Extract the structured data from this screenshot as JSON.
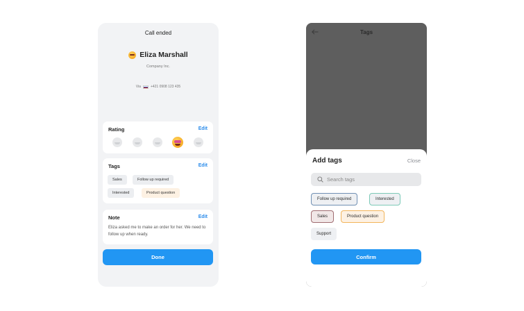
{
  "left": {
    "title": "Call ended",
    "contact_name": "Eliza Marshall",
    "company": "Company Inc.",
    "via_label": "Via",
    "phone": "+421 0908 123 435",
    "rating": {
      "title": "Rating",
      "edit": "Edit",
      "selected_index": 3,
      "count": 5
    },
    "tags": {
      "title": "Tags",
      "edit": "Edit",
      "items": [
        "Sales",
        "Follow up required",
        "Interested",
        "Product question"
      ]
    },
    "note": {
      "title": "Note",
      "edit": "Edit",
      "text": "Eliza asked me to make an order for her. We need to follow up when ready."
    },
    "done_label": "Done"
  },
  "right": {
    "title": "Tags",
    "sheet_title": "Add tags",
    "close_label": "Close",
    "search_placeholder": "Search tags",
    "chips": [
      "Follow up required",
      "Interested",
      "Sales",
      "Product question",
      "Support"
    ],
    "confirm_label": "Confirm"
  },
  "colors": {
    "accent": "#2196f3",
    "overlay": "#5e5e5e"
  }
}
